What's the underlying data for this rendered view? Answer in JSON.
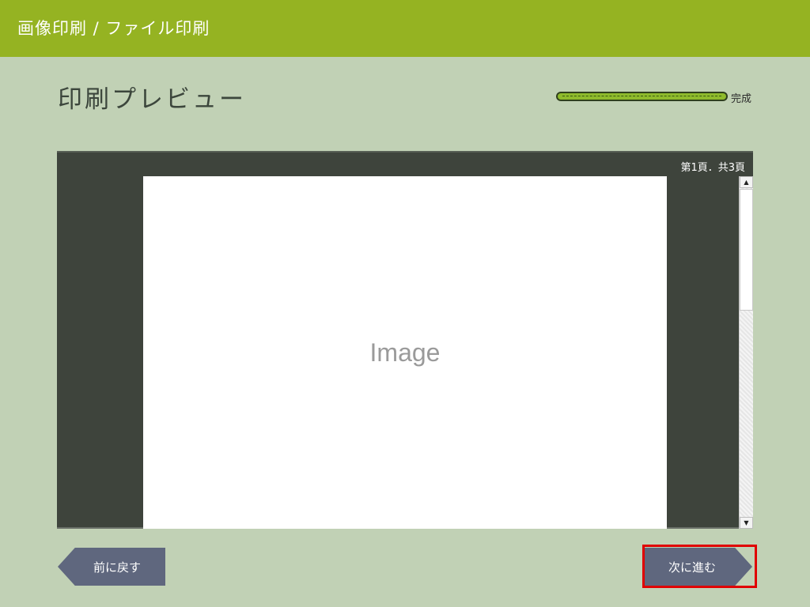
{
  "header": {
    "title": "画像印刷 / ファイル印刷"
  },
  "page": {
    "title": "印刷プレビュー"
  },
  "progress": {
    "label": "完成",
    "value": 1.0,
    "fill_color": "#8fbb2c"
  },
  "preview": {
    "page_indicator": "第1頁．共3頁",
    "placeholder": "Image"
  },
  "scrollbar": {
    "up_icon": "▲",
    "down_icon": "▼"
  },
  "buttons": {
    "back_label": "前に戻す",
    "next_label": "次に進む"
  },
  "colors": {
    "header_bg": "#95b322",
    "page_bg": "#c1d1b5",
    "button_bg": "#5f677e",
    "highlight": "#e00000"
  }
}
